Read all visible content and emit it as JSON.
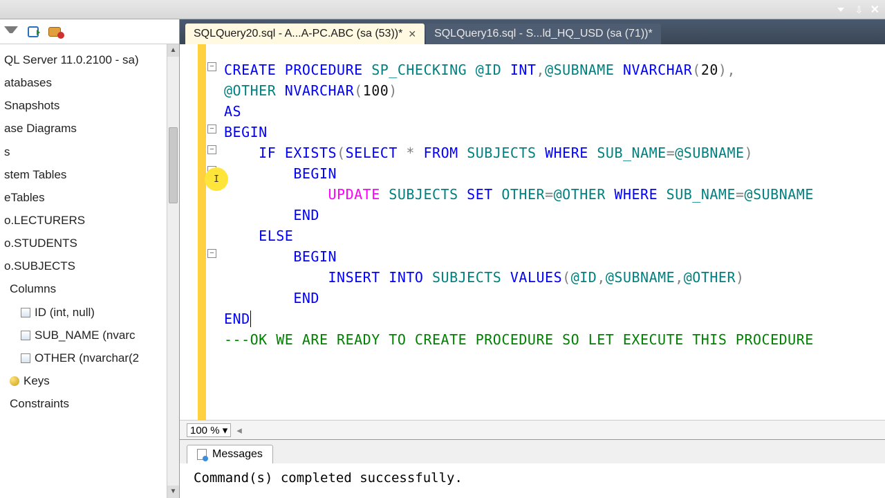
{
  "toolbar": {
    "dropdown": "▼",
    "pin": "⬍",
    "close": "✕"
  },
  "sidebar": {
    "server": "QL Server 11.0.2100 - sa)",
    "nodes": [
      "atabases",
      "Snapshots",
      "",
      "ase Diagrams",
      "s",
      "stem Tables",
      "eTables",
      "o.LECTURERS",
      "o.STUDENTS",
      "o.SUBJECTS"
    ],
    "columns_label": "Columns",
    "cols": [
      "ID (int, null)",
      "SUB_NAME (nvarc",
      "OTHER (nvarchar(2"
    ],
    "keys": "Keys",
    "constraints": "Constraints"
  },
  "tabs": {
    "active": "SQLQuery20.sql - A...A-PC.ABC (sa (53))*",
    "inactive": "SQLQuery16.sql - S...ld_HQ_USD (sa (71))*",
    "close": "✕"
  },
  "code": {
    "l1a": "CREATE",
    "l1b": "PROCEDURE",
    "l1c": "SP_CHECKING",
    "l1d": "@ID",
    "l1e": "INT",
    "l1f": "@SUBNAME",
    "l1g": "NVARCHAR",
    "l1h": "20",
    "l2a": "@OTHER",
    "l2b": "NVARCHAR",
    "l2c": "100",
    "l3": "AS",
    "l4": "BEGIN",
    "l5a": "IF",
    "l5b": "EXISTS",
    "l5c": "SELECT",
    "l5d": "*",
    "l5e": "FROM",
    "l5f": "SUBJECTS",
    "l5g": "WHERE",
    "l5h": "SUB_NAME",
    "l5i": "@SUBNAME",
    "l6": "BEGIN",
    "l7a": "UPDATE",
    "l7b": "SUBJECTS",
    "l7c": "SET",
    "l7d": "OTHER",
    "l7e": "@OTHER",
    "l7f": "WHERE",
    "l7g": "SUB_NAME",
    "l7h": "@SUBNAME",
    "l8": "END",
    "l9": "ELSE",
    "l10": "BEGIN",
    "l11a": "INSERT",
    "l11b": "INTO",
    "l11c": "SUBJECTS",
    "l11d": "VALUES",
    "l11e": "@ID",
    "l11f": "@SUBNAME",
    "l11g": "@OTHER",
    "l12": "END",
    "l13": "END",
    "l14": "---OK WE ARE READY TO CREATE PROCEDURE SO LET EXECUTE THIS PROCEDURE"
  },
  "zoom": {
    "value": "100 %",
    "arrow": "◂"
  },
  "messages": {
    "tab": "Messages",
    "text": "Command(s) completed successfully."
  }
}
